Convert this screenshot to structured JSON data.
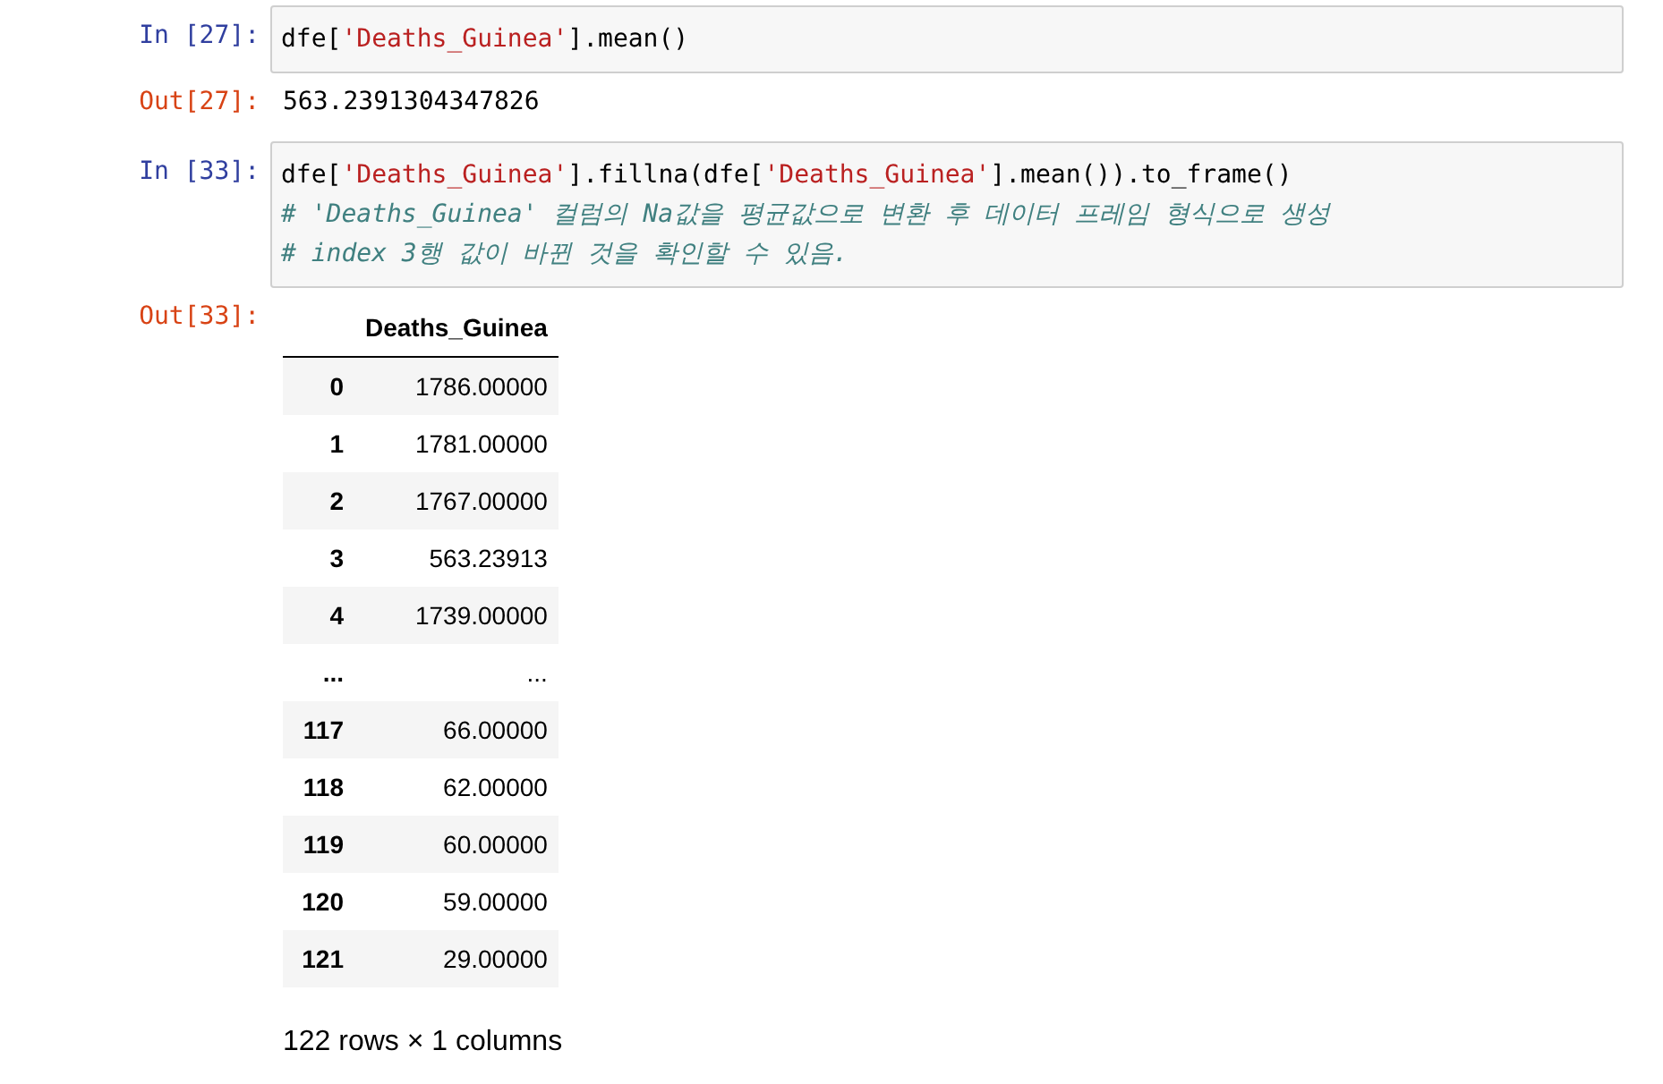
{
  "cells": [
    {
      "kind": "input",
      "prompt": "In [27]:",
      "lines": [
        [
          {
            "kind": "code",
            "text": "dfe["
          },
          {
            "kind": "string",
            "text": "'Deaths_Guinea'"
          },
          {
            "kind": "code",
            "text": "].mean()"
          }
        ]
      ]
    },
    {
      "kind": "output",
      "prompt": "Out[27]:",
      "text": "563.2391304347826"
    },
    {
      "kind": "input",
      "prompt": "In [33]:",
      "lines": [
        [
          {
            "kind": "code",
            "text": "dfe["
          },
          {
            "kind": "string",
            "text": "'Deaths_Guinea'"
          },
          {
            "kind": "code",
            "text": "].fillna(dfe["
          },
          {
            "kind": "string",
            "text": "'Deaths_Guinea'"
          },
          {
            "kind": "code",
            "text": "].mean()).to_frame()"
          }
        ],
        [
          {
            "kind": "comment",
            "text": "# 'Deaths_Guinea' 컬럼의 Na값을 평균값으로 변환 후 데이터 프레임 형식으로 생성"
          }
        ],
        [
          {
            "kind": "comment",
            "text": "# index 3행 값이 바뀐 것을 확인할 수 있음."
          }
        ]
      ]
    },
    {
      "kind": "table",
      "prompt": "Out[33]:",
      "columns": [
        "Deaths_Guinea"
      ],
      "rows": [
        {
          "index": "0",
          "values": [
            "1786.00000"
          ]
        },
        {
          "index": "1",
          "values": [
            "1781.00000"
          ]
        },
        {
          "index": "2",
          "values": [
            "1767.00000"
          ]
        },
        {
          "index": "3",
          "values": [
            "563.23913"
          ]
        },
        {
          "index": "4",
          "values": [
            "1739.00000"
          ]
        },
        {
          "index": "...",
          "values": [
            "..."
          ]
        },
        {
          "index": "117",
          "values": [
            "66.00000"
          ]
        },
        {
          "index": "118",
          "values": [
            "62.00000"
          ]
        },
        {
          "index": "119",
          "values": [
            "60.00000"
          ]
        },
        {
          "index": "120",
          "values": [
            "59.00000"
          ]
        },
        {
          "index": "121",
          "values": [
            "29.00000"
          ]
        }
      ],
      "footer": "122 rows × 1 columns"
    }
  ]
}
